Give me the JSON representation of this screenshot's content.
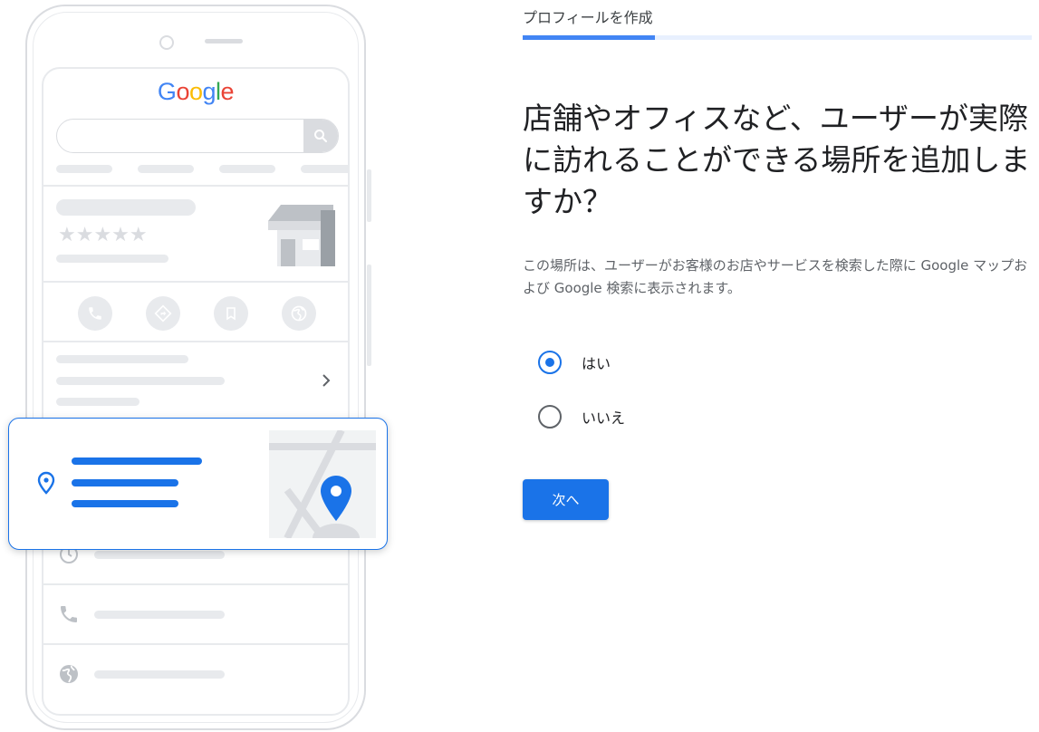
{
  "header": {
    "section_title": "プロフィールを作成"
  },
  "progress": {
    "fraction": 0.26
  },
  "main": {
    "question": "店舗やオフィスなど、ユーザーが実際に訪れることができる場所を追加しますか？",
    "description": "この場所は、ユーザーがお客様のお店やサービスを検索した際に Google マップおよび Google 検索に表示されます。",
    "options": [
      {
        "label": "はい",
        "selected": true
      },
      {
        "label": "いいえ",
        "selected": false
      }
    ],
    "next_label": "次へ"
  },
  "illustration": {
    "logo_text": "Google",
    "rating_stars": "★★★★★",
    "colors": {
      "brand_blue": "#1a73e8",
      "progress_blue": "#4285f4",
      "placeholder_gray": "#e8eaed"
    },
    "icons": [
      "search-icon",
      "phone-icon",
      "directions-icon",
      "bookmark-icon",
      "globe-icon",
      "chevron-right-icon",
      "location-pin-icon",
      "clock-icon",
      "map-pin-icon",
      "storefront-icon"
    ]
  }
}
